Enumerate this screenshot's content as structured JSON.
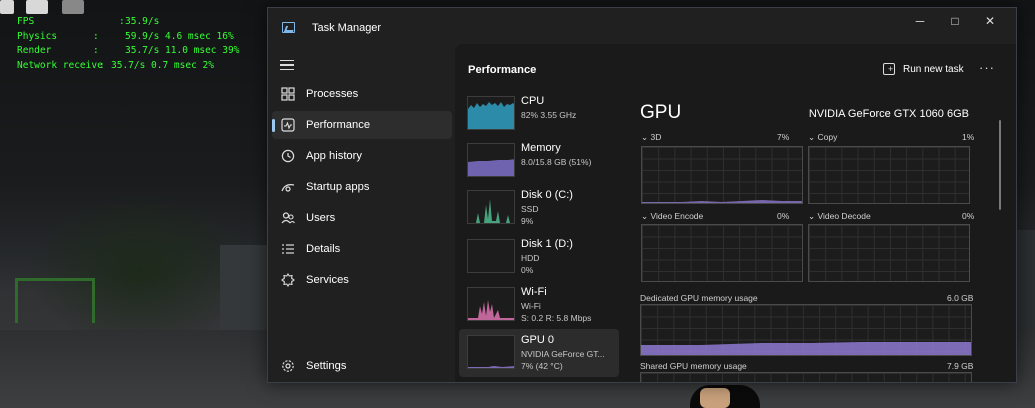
{
  "overlay": {
    "rows": [
      {
        "label": "FPS",
        "sep": ":",
        "value": "35.9/s"
      },
      {
        "label": "Physics",
        "sep": ":",
        "value": "59.9/s 4.6 msec 16%"
      },
      {
        "label": "Render",
        "sep": ":",
        "value": "35.7/s 11.0 msec 39%"
      },
      {
        "label": "Network receive",
        "sep": ":",
        "value": "35.7/s 0.7 msec 2%"
      }
    ],
    "color": "#35ff35"
  },
  "window": {
    "title": "Task Manager",
    "minimize": "─",
    "maximize": "□",
    "close": "✕"
  },
  "sidebar": {
    "items": [
      {
        "label": "Processes",
        "icon": "processes-icon"
      },
      {
        "label": "Performance",
        "icon": "performance-icon",
        "active": true
      },
      {
        "label": "App history",
        "icon": "app-history-icon"
      },
      {
        "label": "Startup apps",
        "icon": "startup-apps-icon"
      },
      {
        "label": "Users",
        "icon": "users-icon"
      },
      {
        "label": "Details",
        "icon": "details-icon"
      },
      {
        "label": "Services",
        "icon": "services-icon"
      }
    ],
    "settings": "Settings"
  },
  "main": {
    "title": "Performance",
    "run_new_task": "Run new task",
    "more": "···"
  },
  "resources": [
    {
      "name": "CPU",
      "sub1": "82% 3.55 GHz",
      "sub2": "",
      "sub3": "",
      "color": "#2f9fc2",
      "active": false
    },
    {
      "name": "Memory",
      "sub1": "8.0/15.8 GB (51%)",
      "sub2": "",
      "sub3": "",
      "color": "#7e6fc8",
      "active": false
    },
    {
      "name": "Disk 0 (C:)",
      "sub1": "SSD",
      "sub2": "9%",
      "sub3": "",
      "color": "#4db38a",
      "active": false
    },
    {
      "name": "Disk 1 (D:)",
      "sub1": "HDD",
      "sub2": "0%",
      "sub3": "",
      "color": "#4db38a",
      "active": false
    },
    {
      "name": "Wi-Fi",
      "sub1": "Wi-Fi",
      "sub2": "S: 0.2 R: 5.8 Mbps",
      "sub3": "",
      "color": "#d36fa8",
      "active": false
    },
    {
      "name": "GPU 0",
      "sub1": "NVIDIA GeForce GT...",
      "sub2": "7% (42 °C)",
      "sub3": "",
      "color": "#8e79d0",
      "active": true
    }
  ],
  "gpu": {
    "title": "GPU",
    "model": "NVIDIA GeForce GTX 1060 6GB",
    "engines": [
      {
        "label": "3D",
        "value": "7%"
      },
      {
        "label": "Copy",
        "value": "1%"
      },
      {
        "label": "Video Encode",
        "value": "0%"
      },
      {
        "label": "Video Decode",
        "value": "0%"
      }
    ],
    "dedicated_label": "Dedicated GPU memory usage",
    "dedicated_value": "6.0 GB",
    "shared_label": "Shared GPU memory usage",
    "shared_value": "7.9 GB"
  }
}
